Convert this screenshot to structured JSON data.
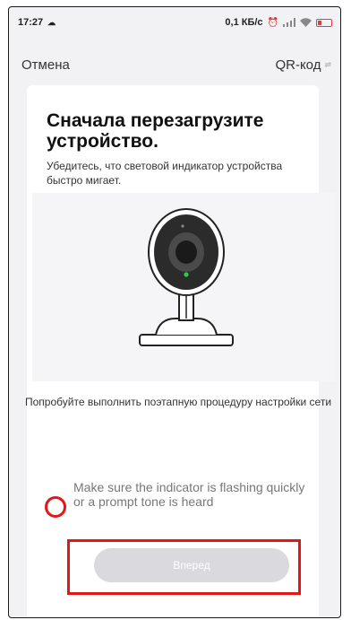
{
  "status_bar": {
    "time": "17:27",
    "net_speed": "0,1 КБ/с"
  },
  "top_bar": {
    "cancel_label": "Отмена",
    "qr_label": "QR-код"
  },
  "card": {
    "title": "Сначала перезагрузите устройство.",
    "subtitle": "Убедитесь, что световой индикатор устройства быстро мигает.",
    "tip": "Попробуйте выполнить поэтапную процедуру настройки сети",
    "checkbox_label": "Make sure the indicator is flashing quickly or a prompt tone is heard",
    "next_label": "Вперед"
  },
  "colors": {
    "highlight_red": "#e21818",
    "button_disabled": "#d9d9de",
    "led_green": "#2ecc40"
  }
}
